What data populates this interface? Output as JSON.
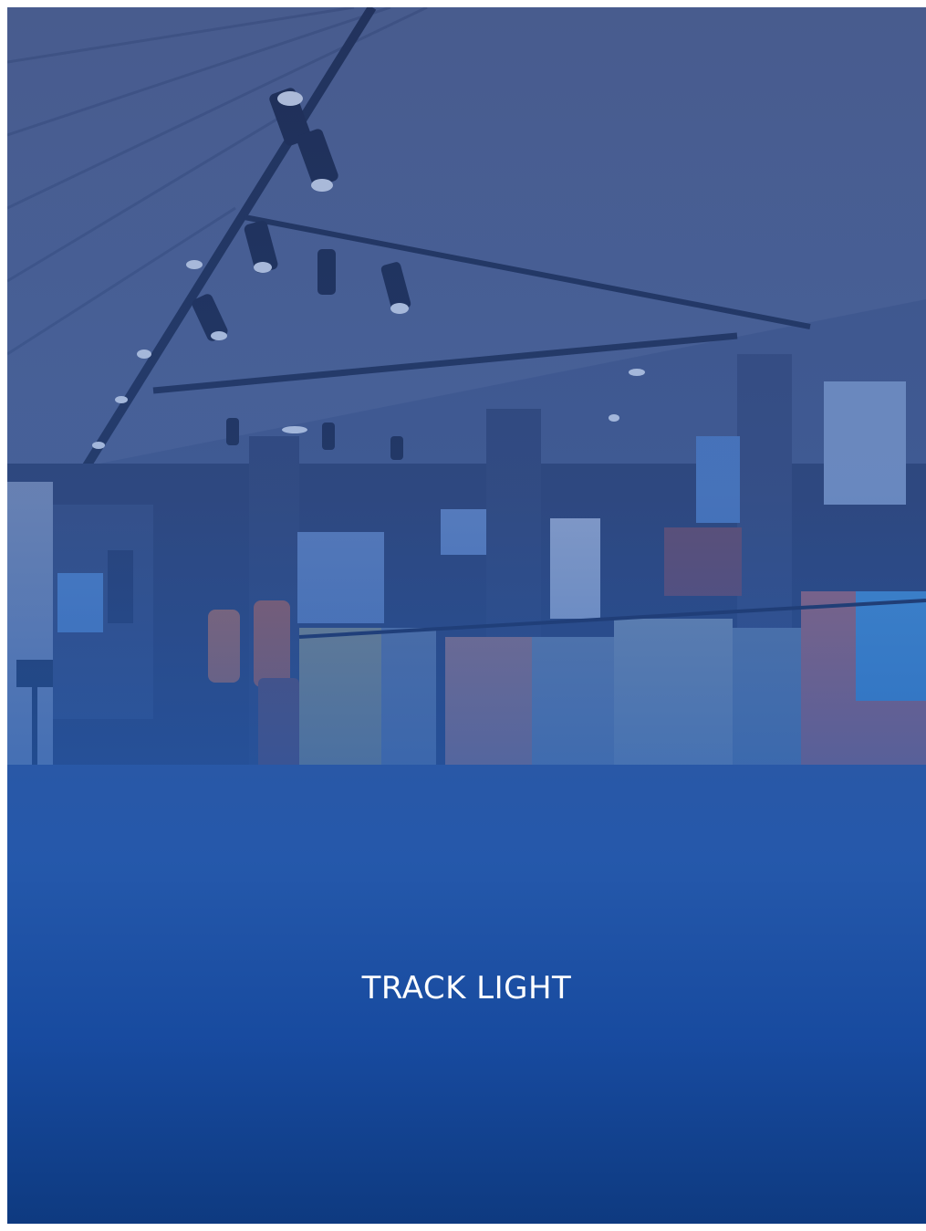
{
  "card": {
    "title": "TRACK LIGHT"
  },
  "colors": {
    "overlay_top": "#3a5a9a",
    "overlay_bottom": "#0e3a80",
    "title_text": "#ffffff"
  }
}
